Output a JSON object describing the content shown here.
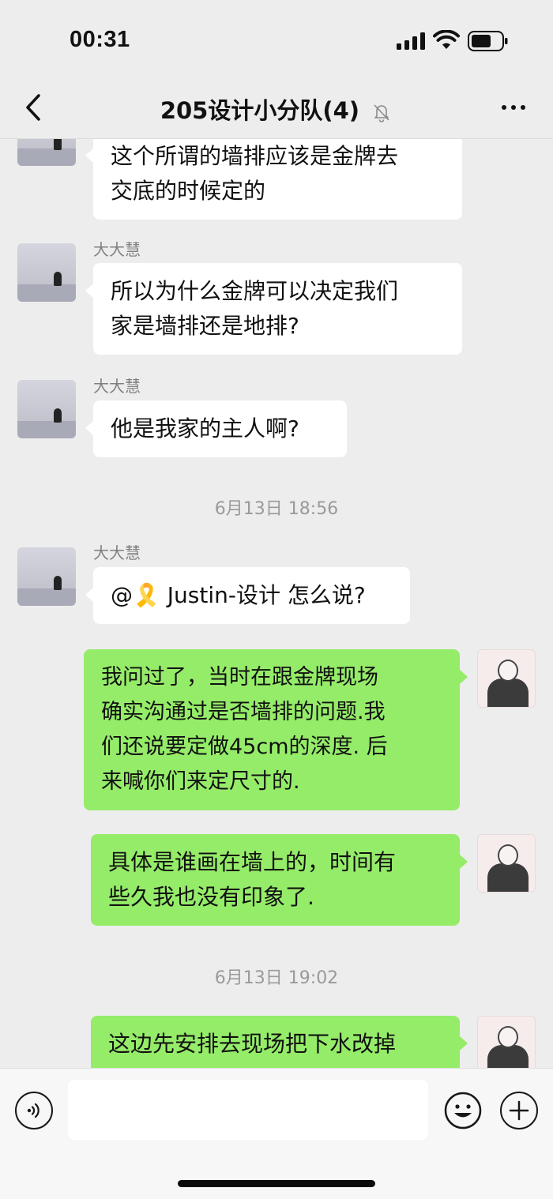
{
  "status_bar": {
    "time": "00:31",
    "icons": [
      "cellular-signal-icon",
      "wifi-icon",
      "battery-icon"
    ]
  },
  "nav": {
    "back_icon": "chevron-left-icon",
    "title": "205设计小分队",
    "member_count": "(4)",
    "mute_icon": "bell-slash-icon",
    "more_icon": "more-dots-icon"
  },
  "messages": [
    {
      "type": "text",
      "side": "left",
      "sender": "",
      "lines": [
        "这个所谓的墙排应该是金牌去",
        "交底的时候定的"
      ]
    },
    {
      "type": "text",
      "side": "left",
      "sender": "大大慧",
      "lines": [
        "所以为什么金牌可以决定我们",
        "家是墙排还是地排?"
      ]
    },
    {
      "type": "text",
      "side": "left",
      "sender": "大大慧",
      "lines": [
        "他是我家的主人啊?"
      ]
    },
    {
      "type": "time",
      "text": "6月13日 18:56"
    },
    {
      "type": "text",
      "side": "left",
      "sender": "大大慧",
      "lines": [
        "@🎗️ Justin-设计 怎么说?"
      ]
    },
    {
      "type": "text",
      "side": "right",
      "lines": [
        "我问过了，当时在跟金牌现场",
        "确实沟通过是否墙排的问题.我",
        "们还说要定做45cm的深度. 后",
        "来喊你们来定尺寸的."
      ]
    },
    {
      "type": "text",
      "side": "right",
      "lines": [
        "具体是谁画在墙上的，时间有",
        "些久我也没有印象了."
      ]
    },
    {
      "type": "time",
      "text": "6月13日 19:02"
    },
    {
      "type": "text",
      "side": "right",
      "lines": [
        "这边先安排去现场把下水改掉"
      ]
    }
  ],
  "input_bar": {
    "voice_icon": "voice-icon",
    "text_value": "",
    "emoji_icon": "emoji-smile-icon",
    "plus_icon": "plus-circle-icon"
  },
  "colors": {
    "background": "#ededed",
    "bubble_self": "#95ec69",
    "bubble_other": "#ffffff",
    "sender_name": "#808080",
    "timestamp": "#9a9a9a"
  }
}
